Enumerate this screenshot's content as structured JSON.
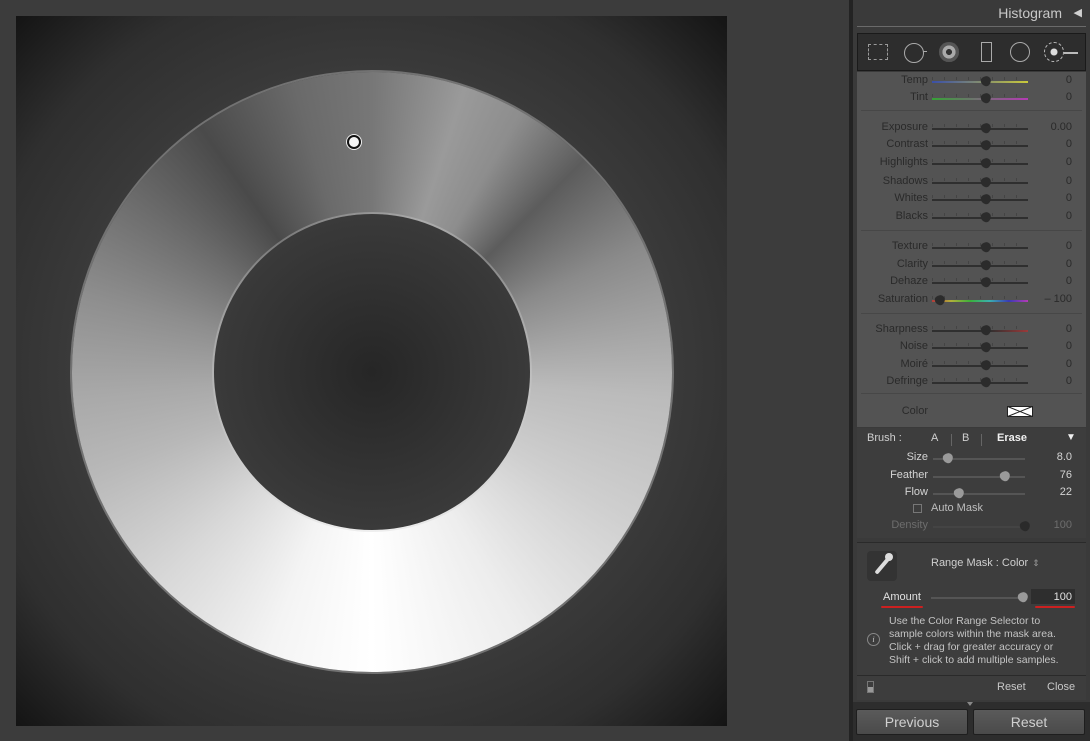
{
  "panel": {
    "histogram_title": "Histogram",
    "collapse_glyph": "◀",
    "tools": [
      "grid-overlay-icon",
      "crop-icon",
      "spot-removal-icon",
      "graduated-filter-icon",
      "radial-filter-icon",
      "adjustment-brush-icon"
    ]
  },
  "sliders": [
    {
      "label": "Temp",
      "value": "0",
      "pos": 0.5,
      "track": "temp"
    },
    {
      "label": "Tint",
      "value": "0",
      "pos": 0.5,
      "track": "tint"
    },
    {
      "label": "Exposure",
      "value": "0.00",
      "pos": 0.5
    },
    {
      "label": "Contrast",
      "value": "0",
      "pos": 0.5
    },
    {
      "label": "Highlights",
      "value": "0",
      "pos": 0.5
    },
    {
      "label": "Shadows",
      "value": "0",
      "pos": 0.5
    },
    {
      "label": "Whites",
      "value": "0",
      "pos": 0.5
    },
    {
      "label": "Blacks",
      "value": "0",
      "pos": 0.5
    },
    {
      "label": "Texture",
      "value": "0",
      "pos": 0.5
    },
    {
      "label": "Clarity",
      "value": "0",
      "pos": 0.5
    },
    {
      "label": "Dehaze",
      "value": "0",
      "pos": 0.5
    },
    {
      "label": "Saturation",
      "value": "– 100",
      "pos": 0.0,
      "track": "sat"
    },
    {
      "label": "Sharpness",
      "value": "0",
      "pos": 0.5,
      "track": "sharp"
    },
    {
      "label": "Noise",
      "value": "0",
      "pos": 0.5
    },
    {
      "label": "Moiré",
      "value": "0",
      "pos": 0.5
    },
    {
      "label": "Defringe",
      "value": "0",
      "pos": 0.5
    }
  ],
  "color_label": "Color",
  "brush": {
    "label": "Brush :",
    "a": "A",
    "b": "B",
    "erase": "Erase",
    "menu_glyph": "▼",
    "size": {
      "label": "Size",
      "value": "8.0",
      "pos": 0.08
    },
    "feather": {
      "label": "Feather",
      "value": "76",
      "pos": 0.76
    },
    "flow": {
      "label": "Flow",
      "value": "22",
      "pos": 0.22
    },
    "auto_mask": "Auto Mask",
    "density": {
      "label": "Density",
      "value": "100",
      "pos": 1.0
    }
  },
  "range_mask": {
    "label": "Range Mask : Color",
    "arrows": "⇕",
    "amount_label": "Amount",
    "amount_value": "100",
    "amount_pos": 1.0,
    "info_glyph": "i",
    "help": [
      "Use the Color Range Selector to",
      "sample colors within the mask area.",
      "Click + drag for greater accuracy or",
      "Shift + click to add multiple samples."
    ]
  },
  "footer": {
    "reset": "Reset",
    "close": "Close"
  },
  "buttons": {
    "previous": "Previous",
    "reset": "Reset"
  }
}
